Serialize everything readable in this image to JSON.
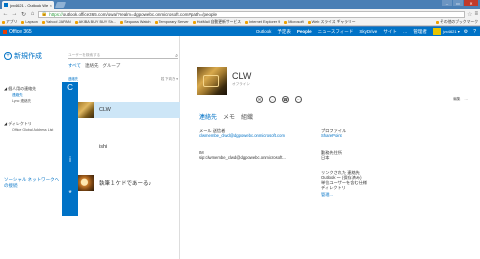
{
  "browser": {
    "tab_title": "jvx4621 - Outlook Web A",
    "tab_close": "×",
    "url_https": "https://",
    "url_rest": "outlook.office365.com/owa/?realm=dgpowebc.onmicrosoft.com#path=/people",
    "window_controls": [
      "–",
      "▭",
      "✕"
    ],
    "bookmarks": [
      "アプリ",
      "Lapson",
      "Yahoo! JAPAN",
      "AKIBA BUY BUY Sh...",
      "Sequoss Watch",
      "Temporary Server",
      "HotMail 自動更新サービス",
      "Internet Explorer 9",
      "Microsoft",
      "Web スライス ギャラリー"
    ],
    "bookmarks_other": "その他のブックマーク"
  },
  "o365": {
    "logo": "Office 365",
    "links": [
      {
        "label": "Outlook",
        "active": false
      },
      {
        "label": "予定表",
        "active": false
      },
      {
        "label": "People",
        "active": true
      },
      {
        "label": "ニュースフィード",
        "active": false
      },
      {
        "label": "SkyDrive",
        "active": false
      },
      {
        "label": "サイト",
        "active": false
      },
      {
        "label": "…",
        "active": false
      },
      {
        "label": "管理者",
        "active": false
      }
    ],
    "user": "jvx4621 ▾"
  },
  "leftnav": {
    "new_label": "新規作成",
    "groups": [
      {
        "title": "◢ 個人用の連絡先",
        "items": [
          {
            "label": "連絡先",
            "selected": true
          },
          {
            "label": "Lync 連絡先",
            "selected": false
          }
        ]
      },
      {
        "title": "◢ ディレクトリ",
        "items": [
          {
            "label": "Office Global Address List",
            "selected": false
          }
        ]
      }
    ],
    "social": "ソーシャル ネットワークへの接続"
  },
  "list": {
    "search_placeholder": "ユーザーを検索する",
    "filters": [
      "すべて",
      "連絡先",
      "グループ"
    ],
    "sort_label": "連絡先",
    "sort_value": "姓 下向き ▾",
    "letters": [
      "C",
      "i",
      "*"
    ],
    "contacts": [
      {
        "name": "CLW",
        "selected": true
      },
      {
        "name": "ishi",
        "selected": false
      },
      {
        "name": "執筆１ケドであーる♪",
        "selected": false
      }
    ]
  },
  "detail": {
    "name": "CLW",
    "status": "オフライン",
    "action_icons": [
      "mail-icon",
      "chat-icon",
      "phone-icon",
      "more-icon"
    ],
    "edit": "編集",
    "more": "…",
    "tabs": [
      "連絡先",
      "メモ",
      "組織"
    ],
    "fields": {
      "email_label": "メール 送信者",
      "email_value": "clwmembe_clwd@dgpowebc.onmicrosoft.com",
      "profile_label": "プロファイル",
      "profile_value": "SharePoint",
      "im_label": "IM",
      "im_value": "sip:clwmembe_clwd@dgpowebc.onmicrosoft...",
      "work_label": "勤務先住所",
      "work_value": "日本",
      "linked_label": "リンクされた 連絡先",
      "linked_values": [
        "Outlook ～ (保存済み)",
        "単位ユーザーを含む仕様",
        "ディレクトリ"
      ],
      "linked_more": "管理..."
    }
  }
}
